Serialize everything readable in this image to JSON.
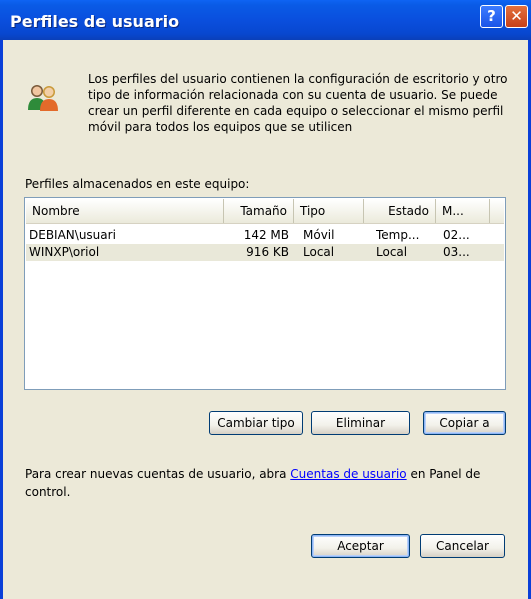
{
  "window": {
    "title": "Perfiles de usuario"
  },
  "titlebar": {
    "help_glyph": "?",
    "close_glyph": "✕"
  },
  "intro_text": "Los perfiles del usuario contienen la configuración de escritorio y otro tipo de información relacionada con su cuenta de usuario. Se puede crear un perfil diferente en cada equipo o seleccionar el mismo perfil móvil para todos los equipos que se utilicen",
  "stored_label": "Perfiles almacenados en este equipo:",
  "profiles": {
    "columns": [
      "Nombre",
      "Tamaño",
      "Tipo",
      "Estado",
      "M..."
    ],
    "rows": [
      [
        "DEBIAN\\usuari",
        "142 MB",
        "Móvil",
        "Temp...",
        "02..."
      ],
      [
        "WINXP\\oriol",
        "916 KB",
        "Local",
        "Local",
        "03..."
      ]
    ]
  },
  "buttons": {
    "change_type": "Cambiar tipo",
    "delete": "Eliminar",
    "copy_to": "Copiar a",
    "ok": "Aceptar",
    "cancel": "Cancelar"
  },
  "note": {
    "before": "Para crear nuevas cuentas de usuario, abra ",
    "link": "Cuentas de usuario",
    "after": " en Panel de control."
  },
  "colors": {
    "titlebar": "#0a4fde",
    "client": "#ece9d8",
    "close": "#d2542a",
    "link": "#0000ff"
  },
  "icons": {
    "users": "users-icon"
  }
}
